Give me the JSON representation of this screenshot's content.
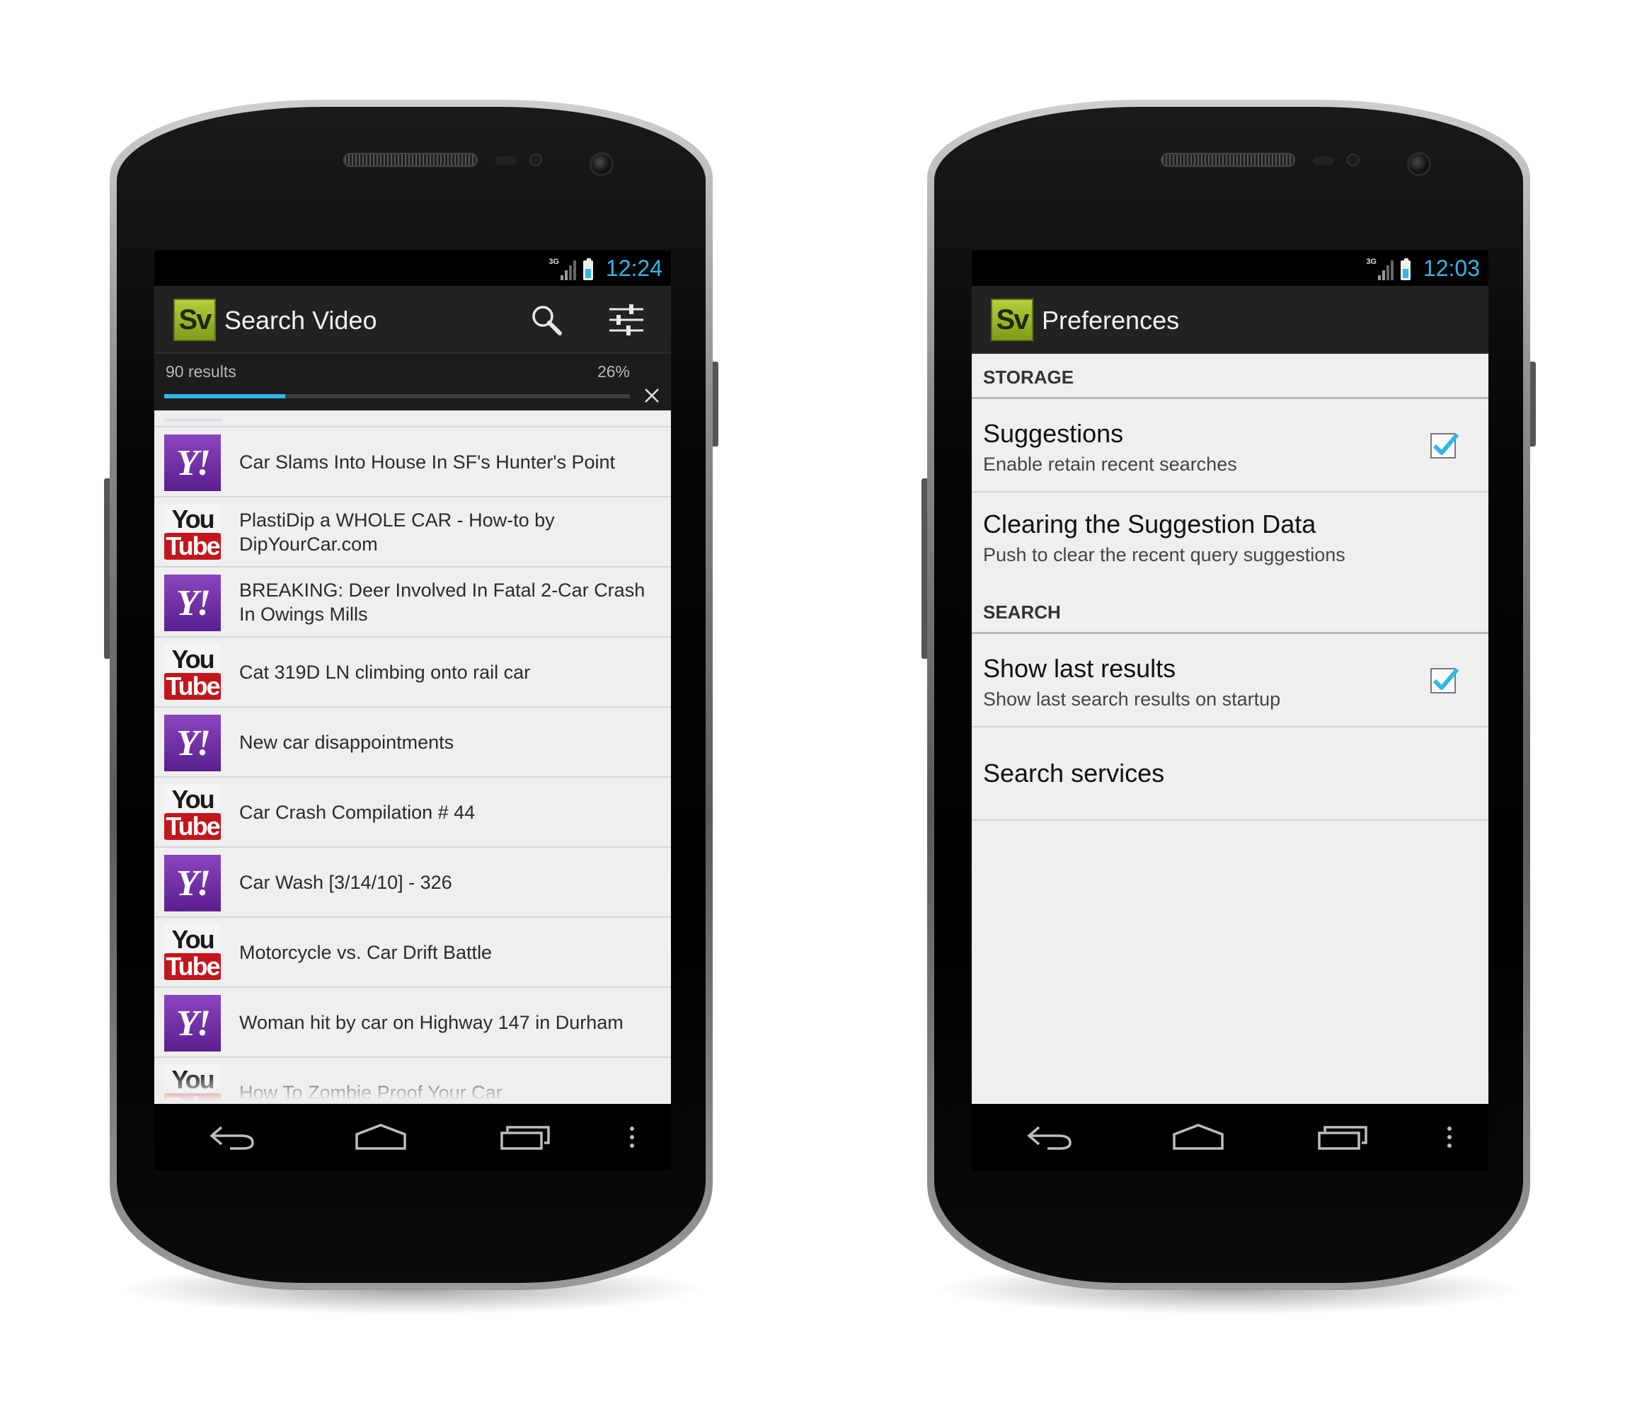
{
  "left_phone": {
    "status": {
      "network": "3G",
      "time": "12:24"
    },
    "app_logo": "Sv",
    "title": "Search Video",
    "actions": {
      "search_icon": "search-icon",
      "settings_icon": "sliders-icon"
    },
    "progress": {
      "count_label": "90 results",
      "percent_label": "26%",
      "value": 0.26
    },
    "results": [
      {
        "source": "yahoo",
        "title": "Car Slams Into House In SF's Hunter's Point"
      },
      {
        "source": "youtube",
        "title": "PlastiDip a WHOLE CAR - How-to by DipYourCar.com"
      },
      {
        "source": "yahoo",
        "title": "BREAKING: Deer Involved In Fatal 2-Car Crash In Owings Mills"
      },
      {
        "source": "youtube",
        "title": "Cat 319D LN climbing onto rail car"
      },
      {
        "source": "yahoo",
        "title": "New car disappointments"
      },
      {
        "source": "youtube",
        "title": "Car Crash Compilation # 44"
      },
      {
        "source": "yahoo",
        "title": "Car Wash [3/14/10] - 326"
      },
      {
        "source": "youtube",
        "title": "Motorcycle vs. Car Drift Battle"
      },
      {
        "source": "yahoo",
        "title": "Woman hit by car on Highway 147 in Durham"
      },
      {
        "source": "youtube",
        "title": "How To Zombie Proof Your Car"
      }
    ],
    "yahoo_logo": {
      "y": "Y",
      "bang": "!"
    },
    "youtube_logo": {
      "you": "You",
      "tube": "Tube"
    }
  },
  "right_phone": {
    "status": {
      "network": "3G",
      "time": "12:03"
    },
    "app_logo": "Sv",
    "title": "Preferences",
    "storage_header": "STORAGE",
    "suggestions": {
      "title": "Suggestions",
      "summary": "Enable retain recent searches",
      "checked": true
    },
    "clearing": {
      "title": "Clearing the Suggestion Data",
      "summary": "Push to clear the recent query suggestions"
    },
    "search_header": "SEARCH",
    "show_last": {
      "title": "Show last results",
      "summary": "Show last search results on startup",
      "checked": true
    },
    "search_services": {
      "title": "Search services"
    }
  },
  "colors": {
    "accent": "#33b5e5",
    "logo_green": "#9bb52a",
    "yahoo_purple": "#6b2aa0",
    "youtube_red": "#c2161c"
  }
}
